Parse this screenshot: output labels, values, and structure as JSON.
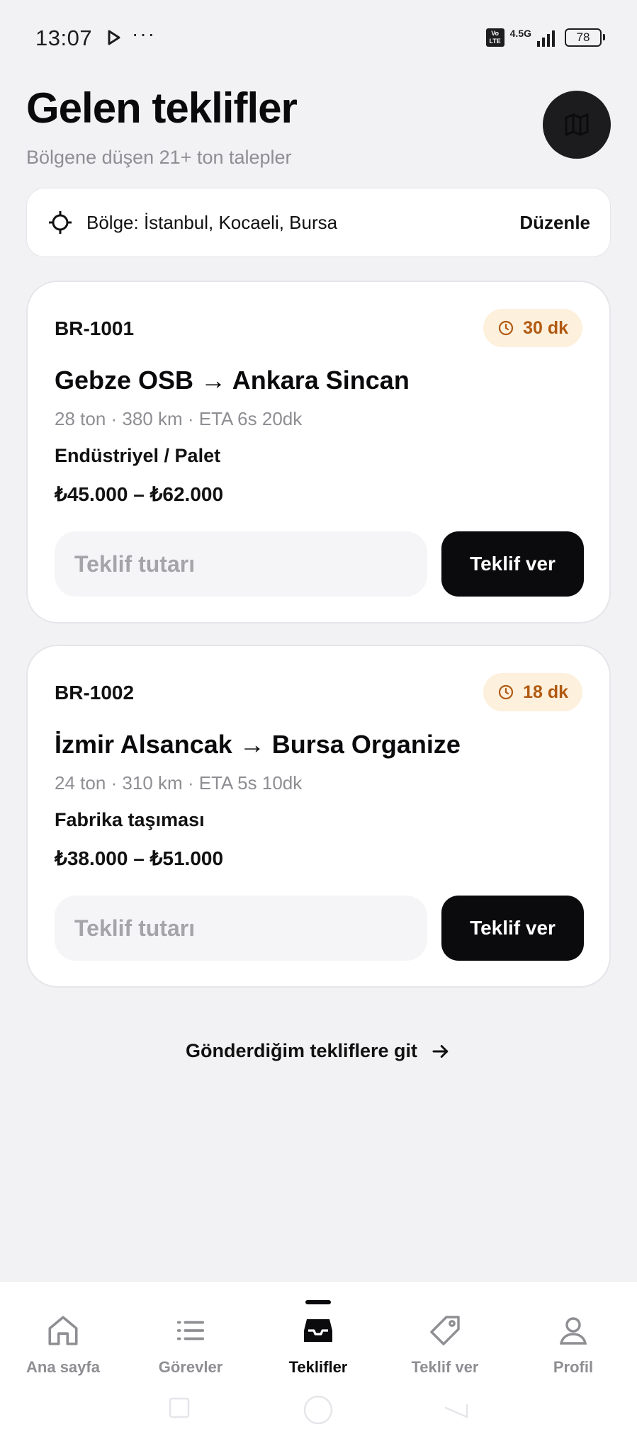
{
  "status_bar": {
    "time": "13:07",
    "dots": "···",
    "volte": "Vo\nLTE",
    "network": "4.5G",
    "battery": "78"
  },
  "header": {
    "title": "Gelen teklifler",
    "subtitle": "Bölgene düşen 21+ ton talepler",
    "map_icon": "map-icon"
  },
  "region": {
    "label": "Bölge: İstanbul, Kocaeli, Bursa",
    "edit_label": "Düzenle",
    "icon": "crosshair-icon"
  },
  "offers": [
    {
      "id": "BR-1001",
      "time_left": "30 dk",
      "route": "Gebze OSB → Ankara Sincan",
      "meta": "28 ton · 380 km · ETA 6s 20dk",
      "cargo": "Endüstriyel / Palet",
      "price_range": "₺45.000 – ₺62.000",
      "input_placeholder": "Teklif tutarı",
      "button_label": "Teklif ver"
    },
    {
      "id": "BR-1002",
      "time_left": "18 dk",
      "route": "İzmir Alsancak → Bursa Organize",
      "meta": "24 ton · 310 km · ETA 5s 10dk",
      "cargo": "Fabrika taşıması",
      "price_range": "₺38.000 – ₺51.000",
      "input_placeholder": "Teklif tutarı",
      "button_label": "Teklif ver"
    }
  ],
  "sent_link": {
    "label": "Gönderdiğim tekliflere git"
  },
  "bottom_nav": {
    "items": [
      {
        "label": "Ana sayfa",
        "icon": "home-icon",
        "active": false
      },
      {
        "label": "Görevler",
        "icon": "list-icon",
        "active": false
      },
      {
        "label": "Teklifler",
        "icon": "inbox-icon",
        "active": true
      },
      {
        "label": "Teklif ver",
        "icon": "tag-icon",
        "active": false
      },
      {
        "label": "Profil",
        "icon": "user-icon",
        "active": false
      }
    ]
  },
  "colors": {
    "background": "#f2f2f4",
    "card": "#ffffff",
    "primary": "#0b0b0d",
    "muted": "#8e8e93",
    "badge_bg": "#fdf0dc",
    "badge_text": "#b15a12"
  }
}
